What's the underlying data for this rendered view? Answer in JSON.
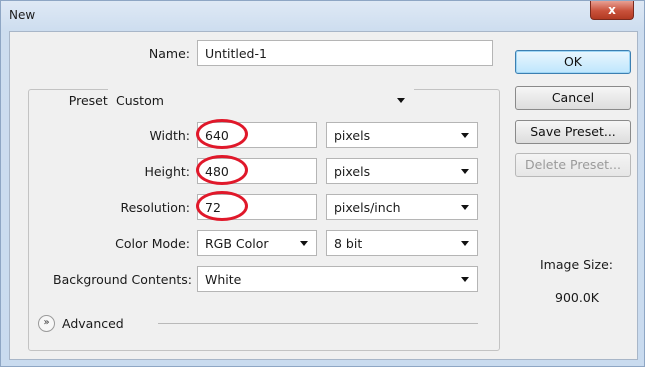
{
  "window": {
    "title": "New",
    "close_glyph": "x"
  },
  "form": {
    "name_label": "Name:",
    "name_value": "Untitled-1",
    "preset_label": "Preset:",
    "preset_value": "Custom",
    "width_label": "Width:",
    "width_value": "640",
    "width_unit": "pixels",
    "height_label": "Height:",
    "height_value": "480",
    "height_unit": "pixels",
    "resolution_label": "Resolution:",
    "resolution_value": "72",
    "resolution_unit": "pixels/inch",
    "color_mode_label": "Color Mode:",
    "color_mode_value": "RGB Color",
    "bit_depth_value": "8 bit",
    "background_label": "Background Contents:",
    "background_value": "White",
    "advanced_label": "Advanced"
  },
  "buttons": {
    "ok": "OK",
    "cancel": "Cancel",
    "save_preset": "Save Preset...",
    "delete_preset": "Delete Preset..."
  },
  "info": {
    "image_size_label": "Image Size:",
    "image_size_value": "900.0K"
  },
  "annotations": {
    "highlight_color": "#e0182a"
  },
  "icons": {
    "advanced_toggle": "chevron-double-down-icon",
    "dropdown": "triangle-down-icon",
    "close": "close-icon"
  }
}
